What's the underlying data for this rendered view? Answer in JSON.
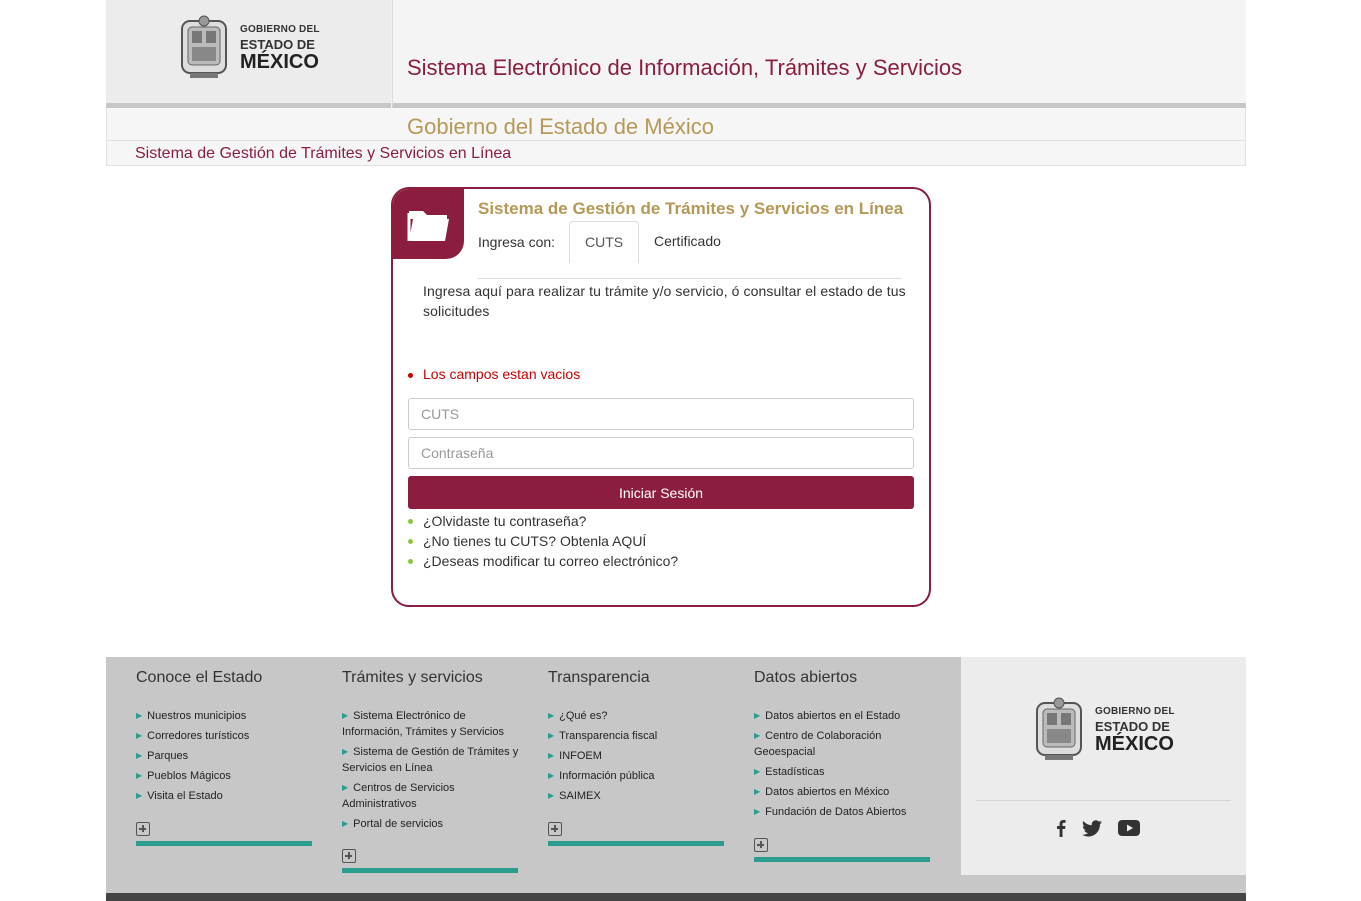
{
  "header": {
    "logo_line1": "GOBIERNO DEL",
    "logo_line2": "ESTADO DE",
    "logo_line3": "MÉXICO",
    "system_title": "Sistema Electrónico de Información, Trámites y Servicios",
    "government_title": "Gobierno del Estado de México",
    "breadcrumb": "Sistema de Gestión de Trámites y Servicios en Línea"
  },
  "login": {
    "title": "Sistema de Gestión de Trámites y Servicios en Línea",
    "login_with_label": "Ingresa con:",
    "tabs": [
      "CUTS",
      "Certificado"
    ],
    "description": "Ingresa aquí para realizar tu trámite y/o servicio, ó consultar el estado de tus solicitudes",
    "error": "Los campos estan vacios",
    "cuts_placeholder": "CUTS",
    "password_placeholder": "Contraseña",
    "submit_label": "Iniciar Sesión",
    "links": [
      "¿Olvidaste tu contraseña?",
      "¿No tienes tu CUTS? Obtenla AQUÍ",
      "¿Deseas modificar tu correo electrónico?"
    ]
  },
  "footer": {
    "columns": [
      {
        "title": "Conoce el Estado",
        "items": [
          "Nuestros municipios",
          "Corredores turísticos",
          "Parques",
          "Pueblos Mágicos",
          "Visita el Estado"
        ]
      },
      {
        "title": "Trámites y servicios",
        "items": [
          "Sistema Electrónico de Información, Trámites y Servicios",
          "Sistema de Gestión de Trámites y Servicios en Línea",
          "Centros de Servicios Administrativos",
          "Portal de servicios"
        ]
      },
      {
        "title": "Transparencia",
        "items": [
          "¿Qué es?",
          "Transparencia fiscal",
          "INFOEM",
          "Información pública",
          "SAIMEX"
        ]
      },
      {
        "title": "Datos abiertos",
        "items": [
          "Datos abiertos en el Estado",
          "Centro de Colaboración Geoespacial",
          "Estadísticas",
          "Datos abiertos en México",
          "Fundación de Datos Abiertos"
        ]
      }
    ],
    "logo_line1": "GOBIERNO DEL",
    "logo_line2": "ESTADO DE",
    "logo_line3": "MÉXICO",
    "social_icons": [
      "facebook-icon",
      "twitter-icon",
      "youtube-icon"
    ]
  },
  "colors": {
    "brand": "#8b1e3f",
    "gold": "#b69857",
    "accent_teal": "#2a9d8f",
    "link_bullet": "#8cc63f",
    "error": "#cc0000"
  }
}
